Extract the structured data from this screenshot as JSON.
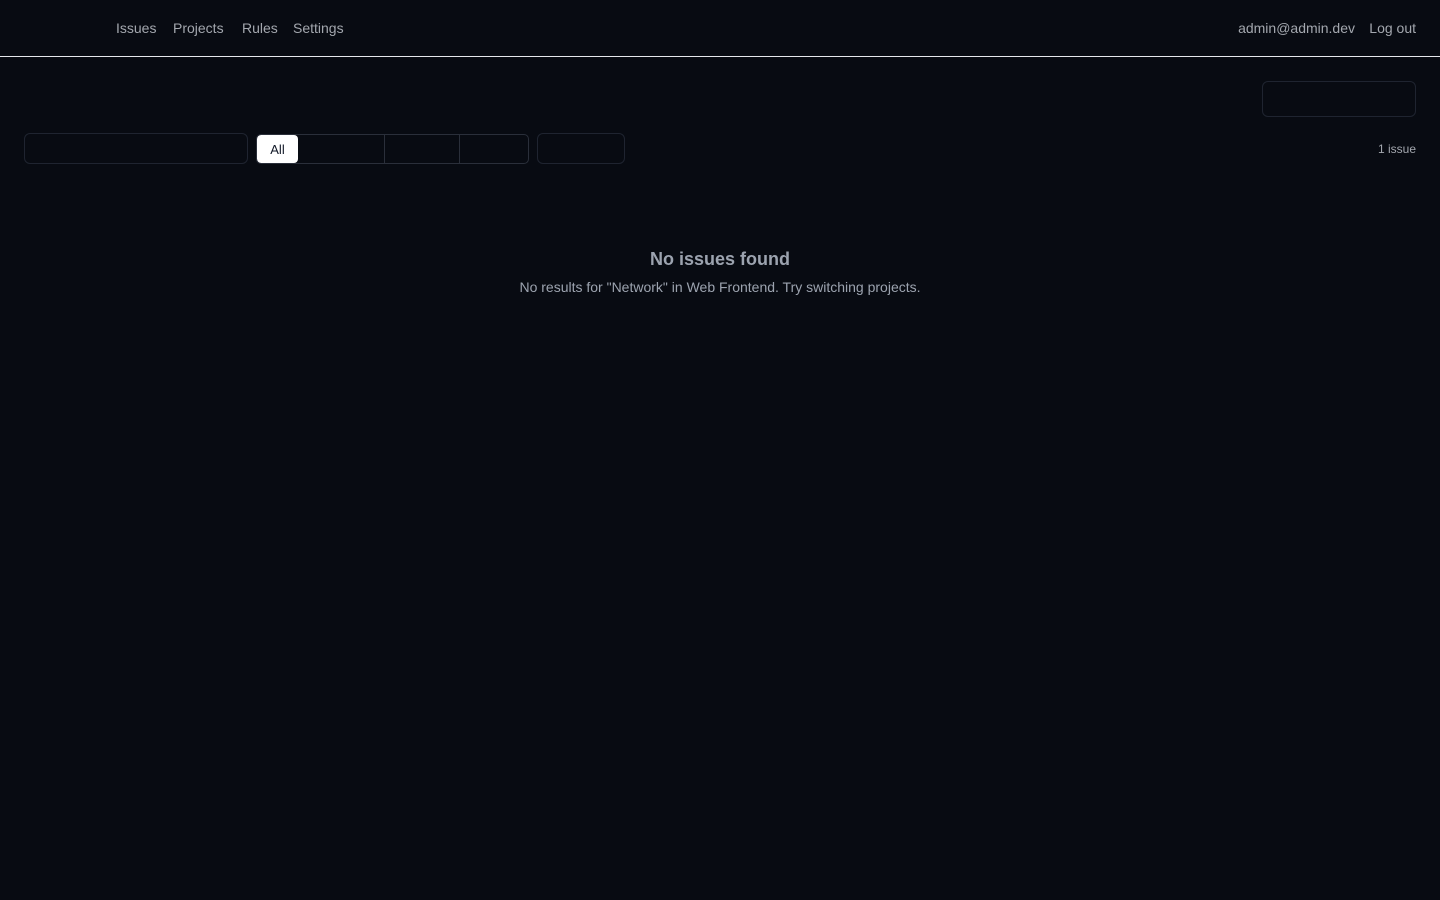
{
  "nav": {
    "items": [
      {
        "label": "Issues"
      },
      {
        "label": "Projects"
      },
      {
        "label": "Rules"
      },
      {
        "label": "Settings"
      }
    ],
    "user_email": "admin@admin.dev",
    "logout_label": "Log out"
  },
  "toolbar": {
    "action_label": "",
    "search": {
      "value": "",
      "placeholder": ""
    },
    "segments": [
      {
        "label": "All",
        "active": true
      },
      {
        "label": ""
      },
      {
        "label": ""
      },
      {
        "label": ""
      }
    ],
    "select_value": "",
    "issue_count": "1 issue"
  },
  "empty_state": {
    "title": "No issues found",
    "subtitle": "No results for \"Network\" in Web Frontend. Try switching projects."
  },
  "colors": {
    "background": "#080b12",
    "divider": "#e5e7eb",
    "text_muted": "#9ca3af",
    "active_segment": "#ffffff"
  }
}
